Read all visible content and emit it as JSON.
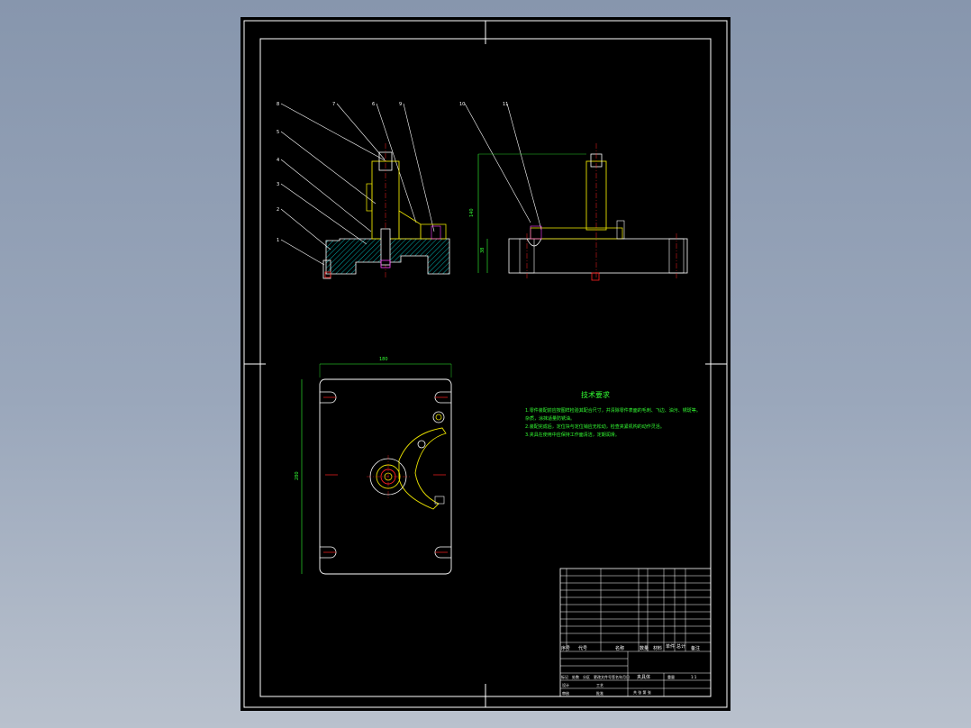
{
  "notes": {
    "title": "技术要求",
    "lines": [
      "1.零件装配前应按图样检验其配合尺寸，并清除零件表面的毛刺、飞边、油污、锈斑等。",
      "杂质，涂抹适量防锈油。",
      "2.装配完成后，定位块与定位销应无松动，检查夹紧机构的动作灵活。",
      "3.夹具在使用中应保持工作面清洁，定期润滑。"
    ]
  },
  "dimensions": {
    "width_top": "180",
    "height_side": "280",
    "height_right": "140",
    "base_right": "38"
  },
  "callouts": [
    "8",
    "7",
    "6",
    "9",
    "10",
    "11",
    "5",
    "4",
    "3",
    "2",
    "1"
  ],
  "title_block": {
    "header_labels": [
      "序号",
      "代号",
      "名称",
      "数量",
      "材料",
      "单件",
      "总计",
      "备注"
    ],
    "sign_labels": [
      "标记",
      "处数",
      "分区",
      "更改文件号",
      "签名",
      "年月日"
    ],
    "role_labels": [
      "设计",
      "审核",
      "工艺",
      "批准"
    ],
    "drawing_name": "夹具体",
    "scale_label": "1:1",
    "weight_label": "重量",
    "sheet_label": "共 张 第 张"
  },
  "colors": {
    "background": "#000000",
    "outline": "#ffffff",
    "part_yellow": "#e8e000",
    "hatch_cyan": "#00c0c0",
    "dim_green": "#33ff33",
    "center_red": "#ff2020",
    "accent_magenta": "#ff40ff"
  }
}
